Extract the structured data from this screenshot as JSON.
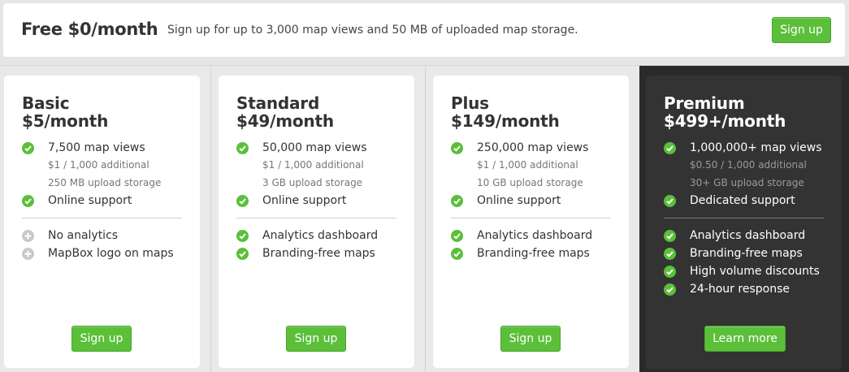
{
  "free": {
    "title": "Free $0/month",
    "description": "Sign up for up to 3,000 map views and 50 MB of uploaded map storage.",
    "button": "Sign up"
  },
  "plans": [
    {
      "name": "Basic",
      "price": "$5/month",
      "views": "7,500 map views",
      "additional": "$1 / 1,000 additional",
      "storage": "250 MB upload storage",
      "support": "Online support",
      "extras": [
        "No analytics",
        "MapBox logo on maps"
      ],
      "extras_icon": "plus-icon",
      "button": "Sign up"
    },
    {
      "name": "Standard",
      "price": "$49/month",
      "views": "50,000 map views",
      "additional": "$1 / 1,000 additional",
      "storage": "3 GB upload storage",
      "support": "Online support",
      "extras": [
        "Analytics dashboard",
        "Branding-free maps"
      ],
      "extras_icon": "check-icon",
      "button": "Sign up"
    },
    {
      "name": "Plus",
      "price": "$149/month",
      "views": "250,000 map views",
      "additional": "$1 / 1,000 additional",
      "storage": "10 GB upload storage",
      "support": "Online support",
      "extras": [
        "Analytics dashboard",
        "Branding-free maps"
      ],
      "extras_icon": "check-icon",
      "button": "Sign up"
    },
    {
      "name": "Premium",
      "price": "$499+/month",
      "views": "1,000,000+ map views",
      "additional": "$0.50 / 1,000 additional",
      "storage": "30+ GB upload storage",
      "support": "Dedicated support",
      "extras": [
        "Analytics dashboard",
        "Branding-free maps",
        "High volume discounts",
        "24-hour response"
      ],
      "extras_icon": "check-icon",
      "button": "Learn more"
    }
  ],
  "colors": {
    "accent_green": "#5bbf3a",
    "premium_bg": "#333333",
    "disabled_icon": "#c9c9c9"
  }
}
